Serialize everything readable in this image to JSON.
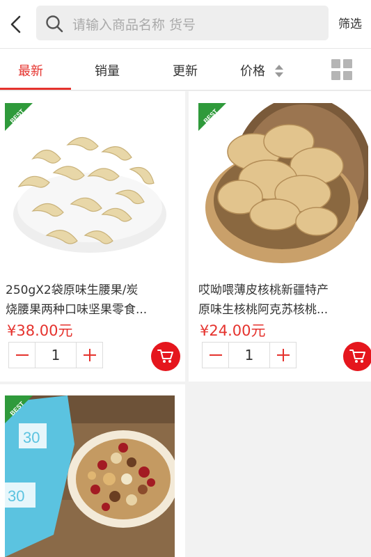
{
  "header": {
    "search_placeholder": "请输入商品名称 货号",
    "filter_label": "筛选"
  },
  "sort_tabs": [
    {
      "label": "最新",
      "active": true
    },
    {
      "label": "销量",
      "active": false
    },
    {
      "label": "更新",
      "active": false
    },
    {
      "label": "价格",
      "active": false
    }
  ],
  "products": [
    {
      "badge": "BEST",
      "title_line1": "250gX2袋原味生腰果/炭",
      "title_line2": "烧腰果两种口味坚果零食...",
      "price": "¥38.00元",
      "quantity": "1"
    },
    {
      "badge": "BEST",
      "title_line1": "哎呦喂薄皮核桃新疆特产",
      "title_line2": "原味生核桃阿克苏核桃...",
      "price": "¥24.00元",
      "quantity": "1"
    },
    {
      "badge": "BEST"
    }
  ],
  "colors": {
    "accent": "#e5322d",
    "badge_green": "#2f9a3b",
    "cart_red": "#e5161d"
  }
}
